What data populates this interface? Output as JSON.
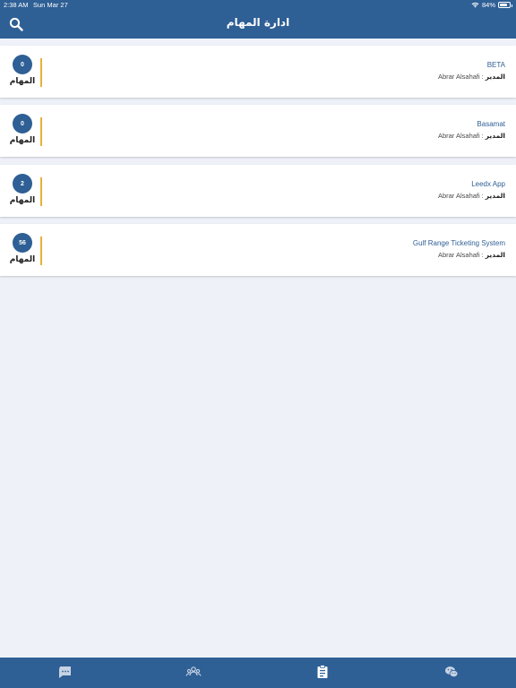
{
  "status_bar": {
    "time": "2:38 AM",
    "date": "Sun Mar 27",
    "battery": "84%",
    "battery_level": 0.84
  },
  "header": {
    "title": "ادارة المهام",
    "search_icon": "search-icon"
  },
  "projects": [
    {
      "name": "BETA",
      "manager_label": "المدير",
      "manager": "Abrar Alsahafi",
      "tasks_count": "0",
      "tasks_label": "المهام"
    },
    {
      "name": "Basamat",
      "manager_label": "المدير",
      "manager": "Abrar Alsahafi",
      "tasks_count": "0",
      "tasks_label": "المهام"
    },
    {
      "name": "Leedx App",
      "manager_label": "المدير",
      "manager": "Abrar Alsahafi",
      "tasks_count": "2",
      "tasks_label": "المهام"
    },
    {
      "name": "Gulf Range Ticketing System",
      "manager_label": "المدير",
      "manager": "Abrar Alsahafi",
      "tasks_count": "56",
      "tasks_label": "المهام"
    }
  ],
  "tab_bar": {
    "tabs": [
      {
        "icon": "chat-bubble-icon"
      },
      {
        "icon": "team-icon"
      },
      {
        "icon": "clipboard-icon"
      },
      {
        "icon": "wechat-icon"
      }
    ]
  },
  "colors": {
    "primary": "#2e5f95",
    "accent": "#e8b03a",
    "background": "#eef2f8"
  }
}
